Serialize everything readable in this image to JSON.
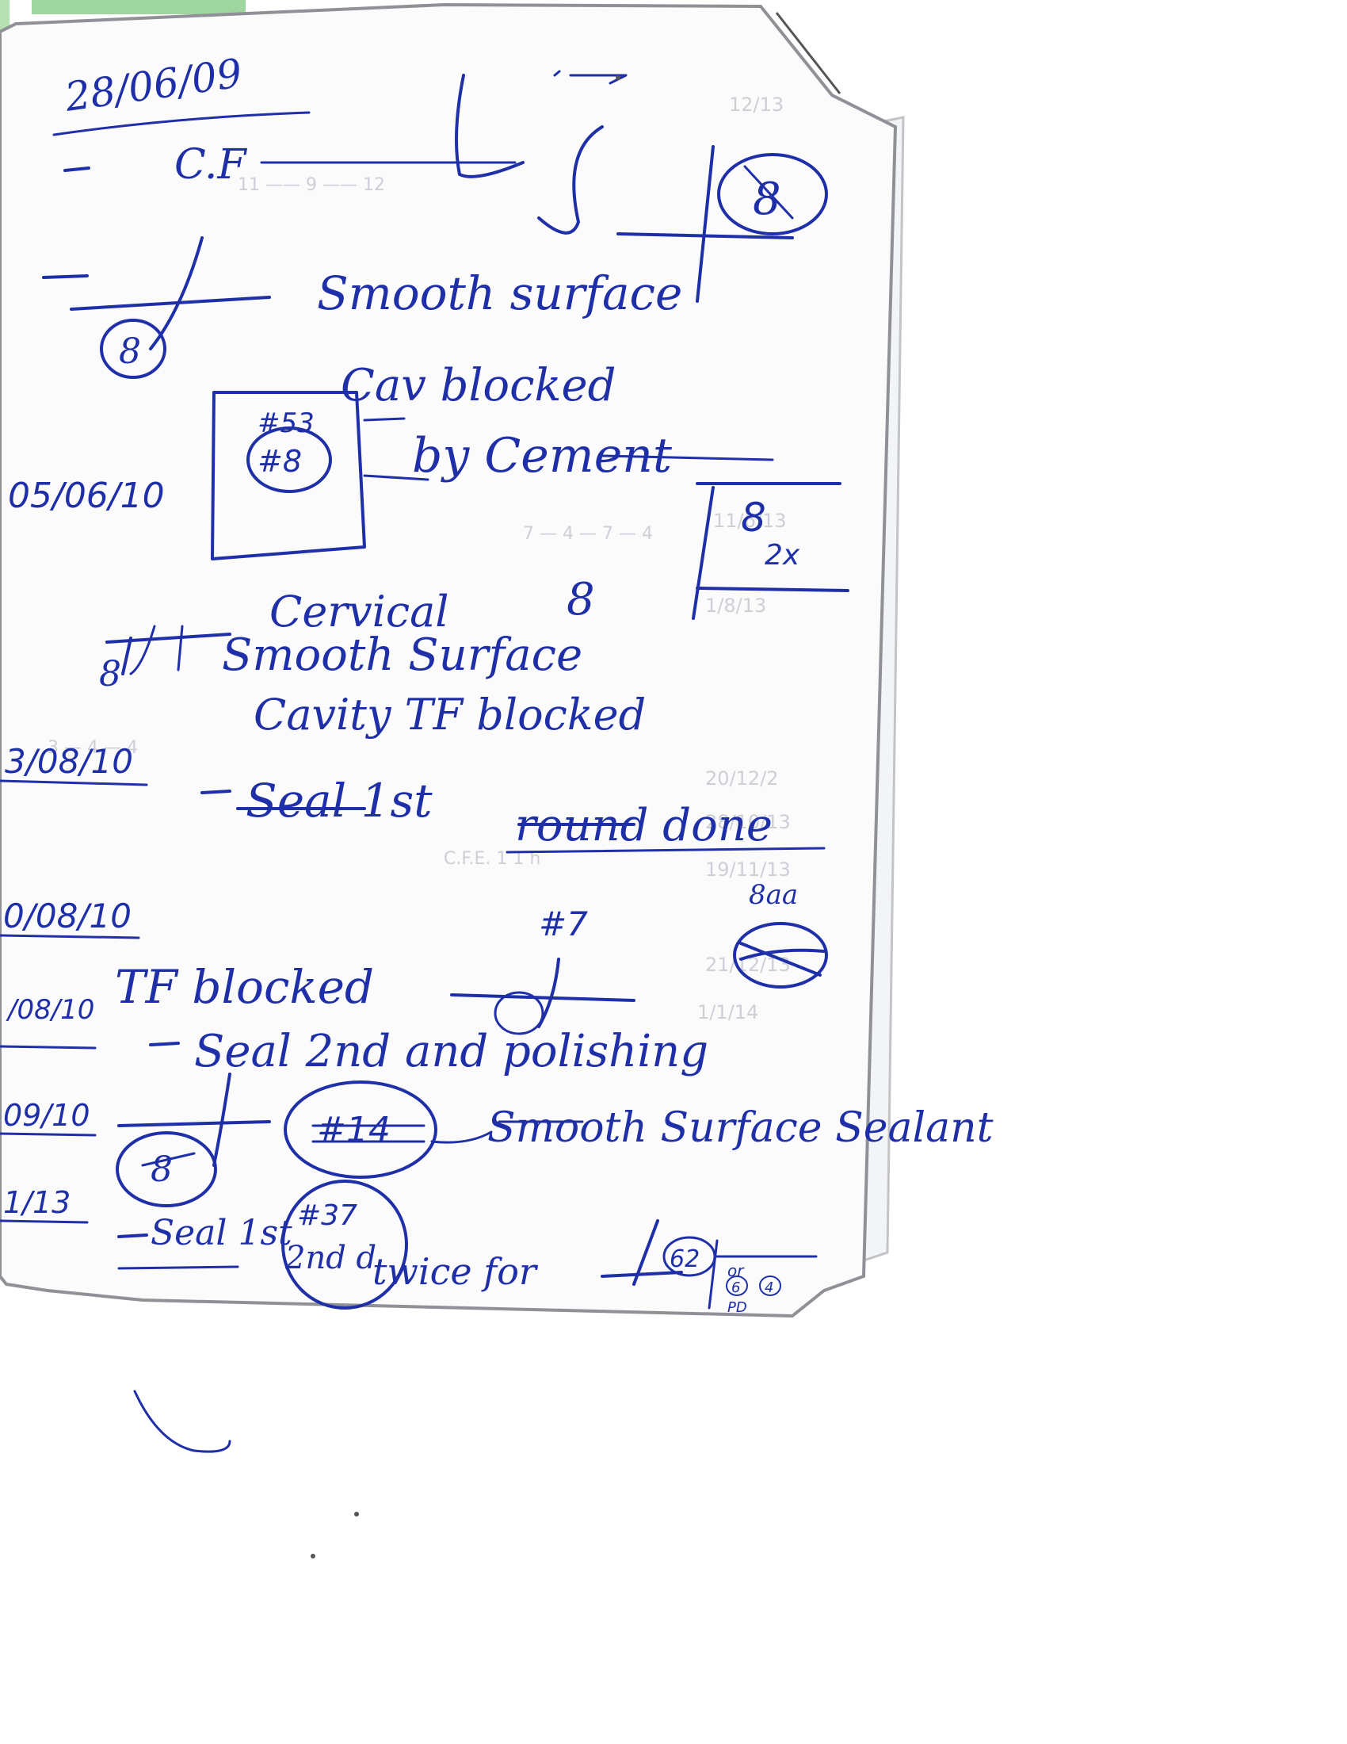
{
  "dates": {
    "d1": "28/06/09",
    "d2": "05/06/10",
    "d3": "3/08/10",
    "d4": "0/08/10",
    "d5": "/08/10",
    "d6": "09/10",
    "d7": "1/13"
  },
  "notes": {
    "cf": "C.F",
    "smooth_surface": "Smooth surface",
    "cavity_blocked": "Cav blocked",
    "by_cement": "by Cement",
    "cervical": "Cervical",
    "smooth_surface_2": "Smooth Surface",
    "cavity_tf_blocked": "Cavity TF blocked",
    "seal_1st": "Seal 1st",
    "round_done": "round done",
    "tf_blocked": "TF blocked",
    "seal_2nd": "Seal 2nd and polishing",
    "smooth_surface_sealant": "Smooth Surface Sealant",
    "seal_1st_2": "Seal 1st",
    "second_d": "2nd d",
    "twice_for": "twice for"
  },
  "tooth_labels": {
    "t_top_circle": "8",
    "t_left_circle": "8",
    "box_53": "#53",
    "box_8": "#8",
    "corner_8": "8",
    "corner_2x": "2x",
    "cervical_8": "8",
    "left_8": "8",
    "num_7": "#7",
    "num_8aa": "8aa",
    "num_14": "#14",
    "lower_8": "8",
    "num_37": "#37",
    "num_62": "62",
    "pd_left": "PD",
    "pd_6": "6",
    "pd_or": "or",
    "pd_4": "4"
  }
}
